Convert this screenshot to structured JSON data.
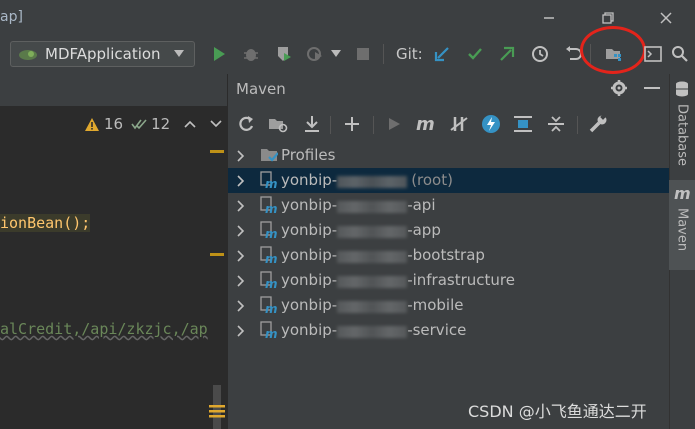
{
  "window": {
    "title_fragment": "ap]"
  },
  "toolbar": {
    "run_config": "MDFApplication",
    "git_label": "Git:"
  },
  "editor": {
    "warnings_count": "16",
    "weak_warnings_count": "12",
    "code_line_1": "ionBean();",
    "code_line_2": "alCredit,/api/zkzjc,/ap"
  },
  "maven": {
    "title": "Maven",
    "tree": [
      {
        "label": "Profiles"
      },
      {
        "prefix": "yonbip-",
        "suffix": "(root)",
        "selected": true
      },
      {
        "prefix": "yonbip-",
        "suffix": "-api"
      },
      {
        "prefix": "yonbip-",
        "suffix": "-app"
      },
      {
        "prefix": "yonbip-",
        "suffix": "-bootstrap"
      },
      {
        "prefix": "yonbip-",
        "suffix": "-infrastructure"
      },
      {
        "prefix": "yonbip-",
        "suffix": "-mobile"
      },
      {
        "prefix": "yonbip-",
        "suffix": "-service"
      }
    ]
  },
  "side_tabs": {
    "database": "Database",
    "maven": "Maven"
  },
  "watermark": "CSDN @小飞鱼通达二开",
  "colors": {
    "highlight_circle": "#e3241b",
    "selection": "#0d293e",
    "run_green": "#499c54",
    "git_blue": "#3592c4"
  }
}
